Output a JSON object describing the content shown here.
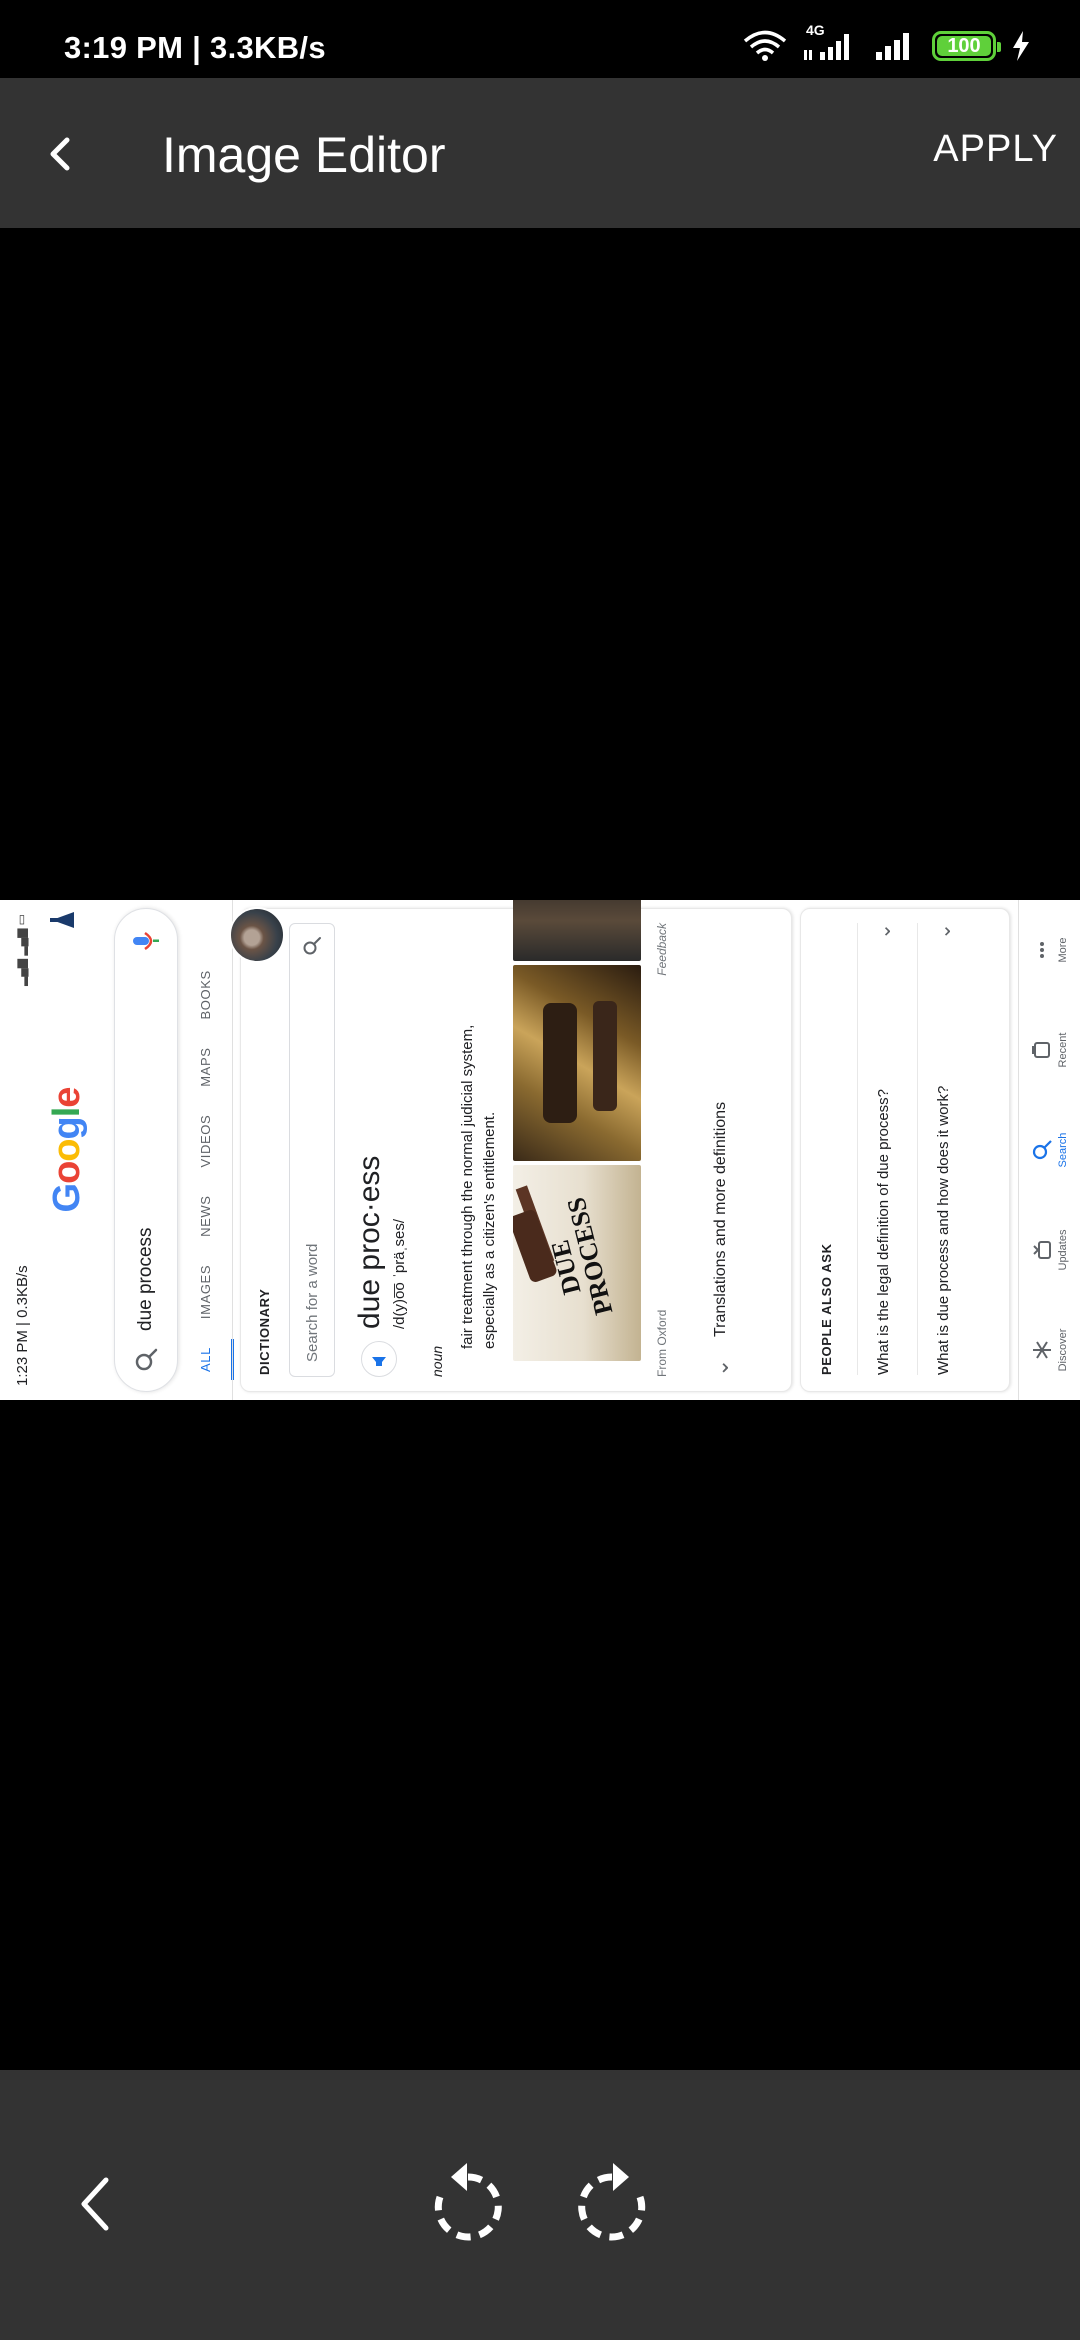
{
  "status_bar": {
    "time": "3:19 PM | 3.3KB/s",
    "network": "4G",
    "battery": "100"
  },
  "app_bar": {
    "title": "Image Editor",
    "apply_label": "APPLY"
  },
  "image": {
    "status_time": "1:23 PM | 0.3KB/s",
    "logo_letters": [
      "G",
      "o",
      "o",
      "g",
      "l",
      "e"
    ],
    "logo_colors": [
      "#4285F4",
      "#EA4335",
      "#FBBC05",
      "#4285F4",
      "#34A853",
      "#EA4335"
    ],
    "search_query": "due process",
    "tabs": [
      "ALL",
      "IMAGES",
      "NEWS",
      "VIDEOS",
      "MAPS",
      "BOOKS"
    ],
    "dictionary": {
      "label": "DICTIONARY",
      "search_placeholder": "Search for a word",
      "word": "due proc·ess",
      "pronunciation": "/d(y)o͞o ˈpräˌses/",
      "part_of_speech": "noun",
      "definition": "fair treatment through the normal judicial system, especially as a citizen's entitlement.",
      "image_text": "DUE PROCESS",
      "source": "From Oxford",
      "feedback": "Feedback",
      "more_label": "Translations and more definitions"
    },
    "people_also_ask": {
      "label": "PEOPLE ALSO ASK",
      "questions": [
        "What is the legal definition of due process?",
        "What is due process and how does it work?"
      ]
    },
    "nav": [
      "Discover",
      "Updates",
      "Search",
      "Recent",
      "More"
    ]
  }
}
